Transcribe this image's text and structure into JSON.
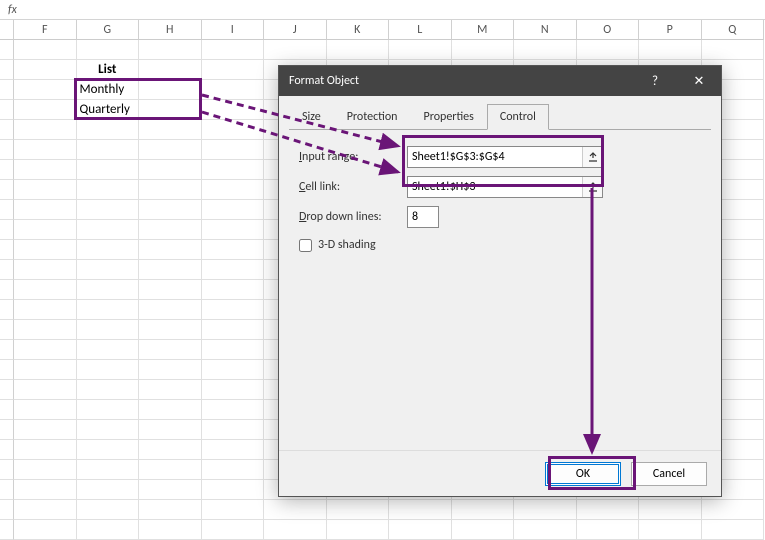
{
  "formula_bar": {
    "fx": "fx"
  },
  "columns": [
    "F",
    "G",
    "H",
    "I",
    "J",
    "K",
    "L",
    "M",
    "N",
    "O",
    "P",
    "Q"
  ],
  "list": {
    "header": "List",
    "items": [
      "Monthly",
      "Quarterly"
    ]
  },
  "dialog": {
    "title": "Format Object",
    "help": "?",
    "close": "✕",
    "tabs": [
      "Size",
      "Protection",
      "Properties",
      "Control"
    ],
    "active_tab": "Control",
    "labels": {
      "input_range_pre": "I",
      "input_range": "nput range:",
      "cell_link_pre": "C",
      "cell_link": "ell link:",
      "dropdown_pre": "D",
      "dropdown": "rop down lines:",
      "shading_pre": "3",
      "shading": "-D shading"
    },
    "values": {
      "input_range": "Sheet1!$G$3:$G$4",
      "cell_link": "Sheet1!$H$3",
      "dropdown": "8"
    },
    "buttons": {
      "ok": "OK",
      "cancel": "Cancel"
    }
  }
}
